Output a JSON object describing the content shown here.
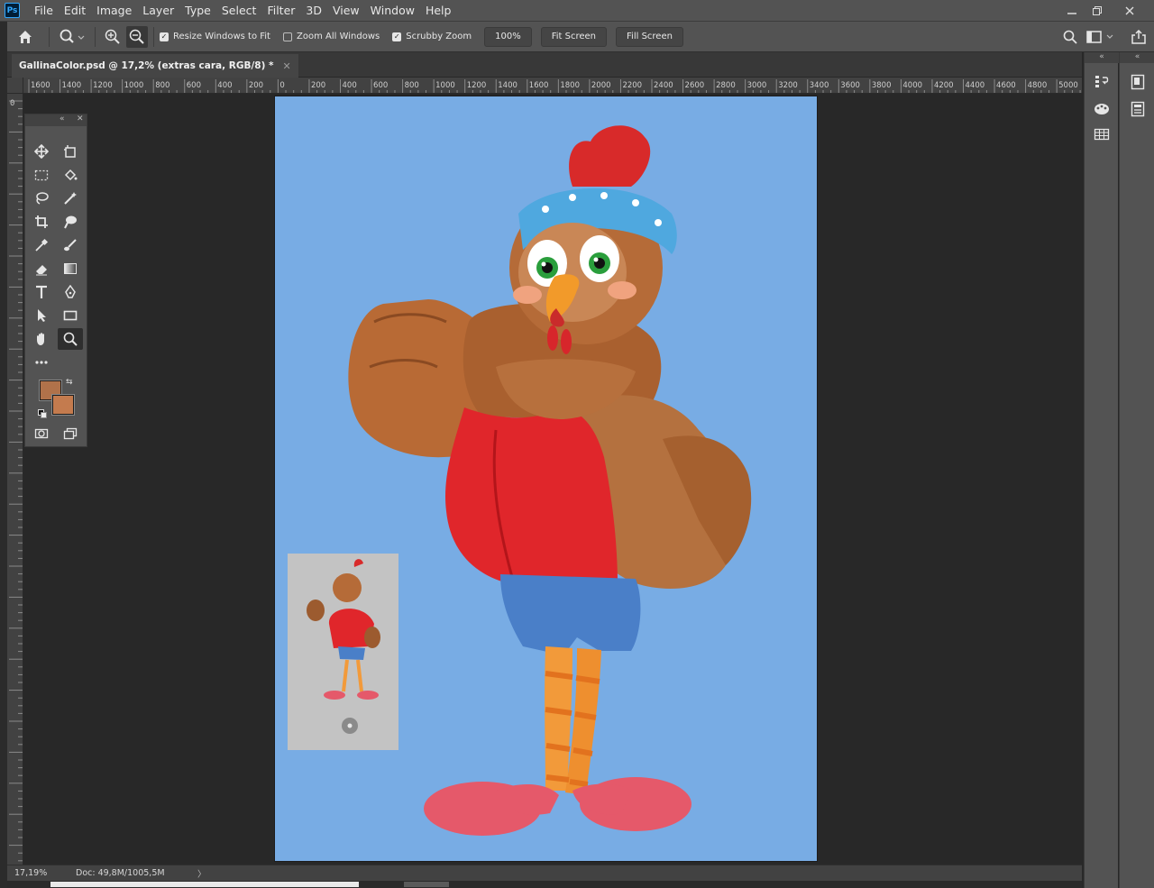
{
  "app": {
    "logo_text": "Ps"
  },
  "menu": [
    "File",
    "Edit",
    "Image",
    "Layer",
    "Type",
    "Select",
    "Filter",
    "3D",
    "View",
    "Window",
    "Help"
  ],
  "options": {
    "resize_windows": "Resize Windows to Fit",
    "zoom_all": "Zoom All Windows",
    "scrubby_zoom": "Scrubby Zoom",
    "btn_100": "100%",
    "btn_fit": "Fit Screen",
    "btn_fill": "Fill Screen",
    "resize_checked": true,
    "zoom_all_checked": false,
    "scrubby_checked": true
  },
  "document": {
    "tab_title": "GallinaColor.psd @ 17,2% (extras cara, RGB/8) *",
    "canvas_color": "#78ace4"
  },
  "ruler_top": [
    "1600",
    "1400",
    "1200",
    "1000",
    "800",
    "600",
    "400",
    "200",
    "0",
    "200",
    "400",
    "600",
    "800",
    "1000",
    "1200",
    "1400",
    "1600",
    "1800",
    "2000",
    "2200",
    "2400",
    "2600",
    "2800",
    "3000",
    "3200",
    "3400",
    "3600",
    "3800",
    "4000",
    "4200",
    "4400",
    "4600",
    "4800",
    "5000"
  ],
  "ruler_left_zero": "0",
  "colors": {
    "foreground": "#b0724a",
    "background": "#c47b4e",
    "accent": "#31a8ff"
  },
  "status": {
    "zoom": "17,19%",
    "doc": "Doc: 49,8M/1005,5M",
    "arrow": "〉"
  }
}
